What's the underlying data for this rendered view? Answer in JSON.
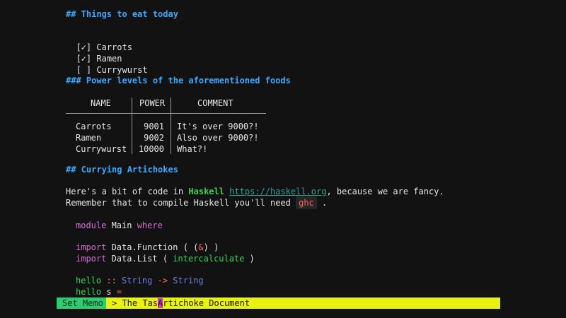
{
  "doc": {
    "heading1": "## Things to eat today",
    "checklist": [
      {
        "box": "[✓]",
        "label": "Carrots"
      },
      {
        "box": "[✓]",
        "label": "Ramen"
      },
      {
        "box": "[ ]",
        "label": "Currywurst"
      }
    ],
    "heading2": "### Power levels of the aforementioned foods",
    "table": {
      "headers": [
        "NAME",
        "POWER",
        "COMMENT"
      ],
      "rows": [
        [
          "Carrots",
          "9001",
          "It's over 9000?!"
        ],
        [
          "Ramen",
          "9002",
          "Also over 9000?!"
        ],
        [
          "Currywurst",
          "10000",
          "What?!"
        ]
      ]
    },
    "heading3": "## Currying Artichokes",
    "para1": {
      "before": "Here's a bit of code in ",
      "bold": "Haskell",
      "space": " ",
      "link": "https://haskell.org",
      "after": ", because we are fancy."
    },
    "para2": {
      "before": "Remember that to compile Haskell you'll need ",
      "code": "ghc",
      "after": " ."
    },
    "code": {
      "l1_kw1": "module",
      "l1_mid": " Main ",
      "l1_kw2": "where",
      "l2_kw": "import",
      "l2_mid": " Data.Function ( (",
      "l2_op": "&",
      "l2_end": ") )",
      "l3_kw": "import",
      "l3_mid": " Data.List ( ",
      "l3_fn": "intercalculate",
      "l3_end": " )",
      "l4_fn": "hello",
      "l4_op1": " ::",
      "l4_t1": " String",
      "l4_op2": " ->",
      "l4_t2": " String",
      "l5_fn": "hello",
      "l5_mid": " s ",
      "l5_op": "="
    }
  },
  "statusbar": {
    "mode": "Set Memo",
    "prompt_before": "> The Tas",
    "prompt_cursor": "A",
    "prompt_after": "rtichoke Document"
  },
  "colors": {
    "background": "#121212",
    "heading": "#3aa8ff",
    "keyword": "#d26ed4",
    "function": "#39d353",
    "type": "#6f7ddf",
    "status_mode": "#2ecc71",
    "status_prompt": "#e9f20f"
  }
}
